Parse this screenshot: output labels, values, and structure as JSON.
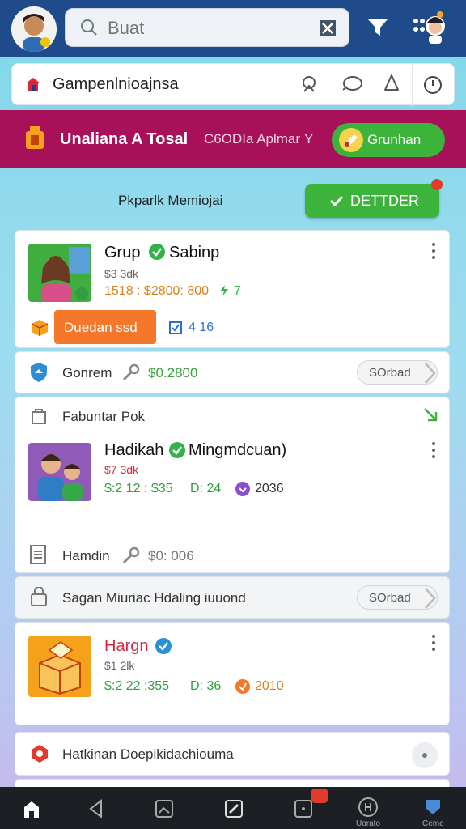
{
  "header": {
    "search_placeholder": "Buat"
  },
  "address": {
    "text": "Gampenlnioajnsa"
  },
  "banner": {
    "title": "Unaliana A Tosal",
    "subtitle": "C6ODIa Aplmar",
    "chevron": "Y",
    "button": "Grunhan"
  },
  "section": {
    "title": "Pkparlk Memiojai",
    "button": "DETTDER"
  },
  "cards": [
    {
      "name": "Grup",
      "verified_name": "Sabinp",
      "price": "$3 3dk",
      "stats": "1518 : $2800: 800",
      "stat_extra": "7",
      "tag": "Duedan ssd",
      "tag_count": "4 16"
    },
    {
      "row_label": "Gonrem",
      "row_value": "$0.2800",
      "pill": "SOrbad"
    },
    {
      "header": "Fabuntar Pok",
      "name": "Hadikah",
      "verified_name": "Mingmdcuan)",
      "price": "$7 3dk",
      "stats_a": "$:2 12 : $35",
      "stats_b": "D: 24",
      "stats_c": "2036",
      "row_label": "Hamdin",
      "row_value": "$0: 006"
    },
    {
      "row_label": "Sagan Miuriac Hdaling iuuond",
      "pill": "SOrbad"
    },
    {
      "name": "Hargn",
      "price": "$1 2lk",
      "stats_a": "$:2 22 :355",
      "stats_b": "D: 36",
      "stats_c": "2010"
    },
    {
      "row_label": "Hatkinan Doepikidachiouma"
    }
  ],
  "bottom_nav": {
    "label_5": "Uorato",
    "label_6": "Ceme"
  },
  "colors": {
    "topbar": "#1f4b8a",
    "banner": "#a8105a",
    "accent_green": "#3cb43c",
    "tag_orange": "#f4772a"
  }
}
